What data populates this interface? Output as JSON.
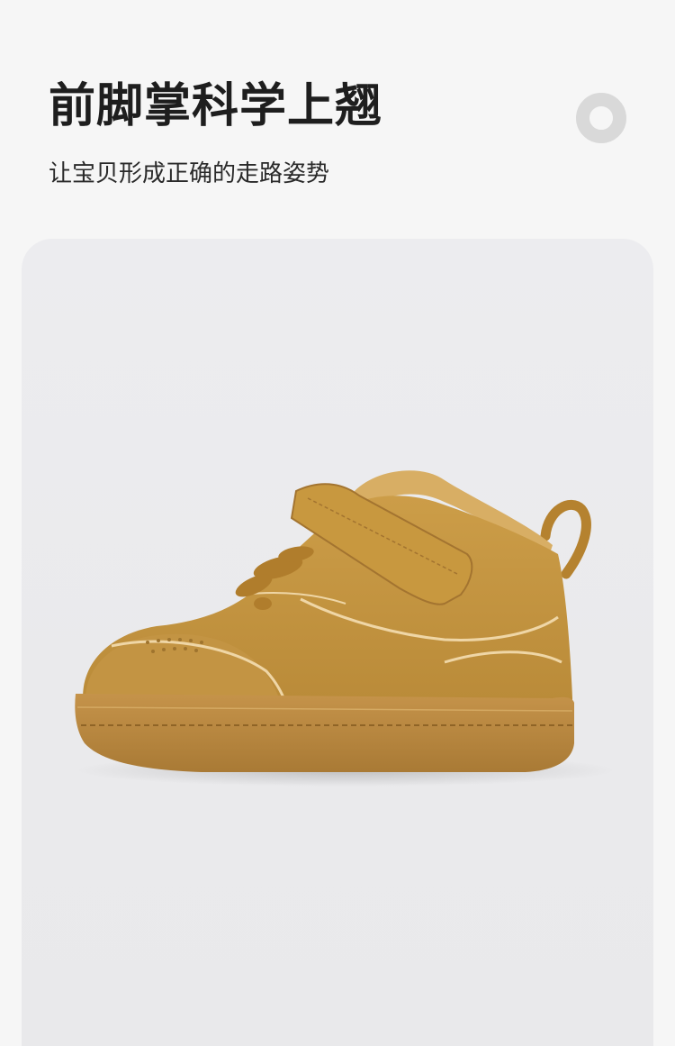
{
  "heading": {
    "title": "前脚掌科学上翘",
    "subtitle": "让宝贝形成正确的走路姿势"
  },
  "product": {
    "image_icon": "high-top-baby-sneaker-icon",
    "colors": {
      "leather": "#c2933f",
      "sole": "#b9883b",
      "fur_lining": "#d7ad63",
      "background": "#eaeaec"
    }
  },
  "decoration": {
    "ring_icon": "circle-ring-icon"
  }
}
